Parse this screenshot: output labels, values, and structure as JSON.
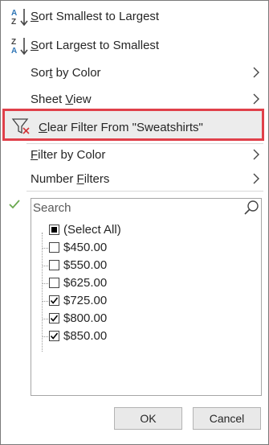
{
  "menu": {
    "sort_asc": {
      "pre": "",
      "key": "S",
      "post": "ort Smallest to Largest"
    },
    "sort_desc": {
      "pre": "",
      "key": "S",
      "post": "ort Largest to Smallest"
    },
    "sort_by_color": {
      "pre": "Sor",
      "key": "t",
      "post": " by Color"
    },
    "sheet_view": {
      "pre": "Sheet ",
      "key": "V",
      "post": "iew"
    },
    "clear_filter": {
      "pre": "",
      "key": "C",
      "post": "lear Filter From \"Sweatshirts\""
    },
    "filter_by_color": {
      "pre": "",
      "key": "F",
      "post": "ilter by Color"
    },
    "number_filters": {
      "pre": "Number ",
      "key": "F",
      "post": "ilters"
    }
  },
  "search": {
    "placeholder": "Search"
  },
  "list": {
    "select_all": {
      "label": "(Select All)",
      "state": "partial"
    },
    "items": [
      {
        "label": "$450.00",
        "checked": false
      },
      {
        "label": "$550.00",
        "checked": false
      },
      {
        "label": "$625.00",
        "checked": false
      },
      {
        "label": "$725.00",
        "checked": true
      },
      {
        "label": "$800.00",
        "checked": true
      },
      {
        "label": "$850.00",
        "checked": true
      }
    ]
  },
  "buttons": {
    "ok": "OK",
    "cancel": "Cancel"
  },
  "colors": {
    "highlight_border": "#e0404a",
    "sort_icon_blue": "#2e75b6",
    "clear_icon_red": "#d13438",
    "check_green": "#6aa84f"
  },
  "icons": [
    "sort-az-icon",
    "sort-za-icon",
    "chevron-right-icon",
    "clear-filter-icon",
    "checkmark-icon",
    "search-icon"
  ]
}
